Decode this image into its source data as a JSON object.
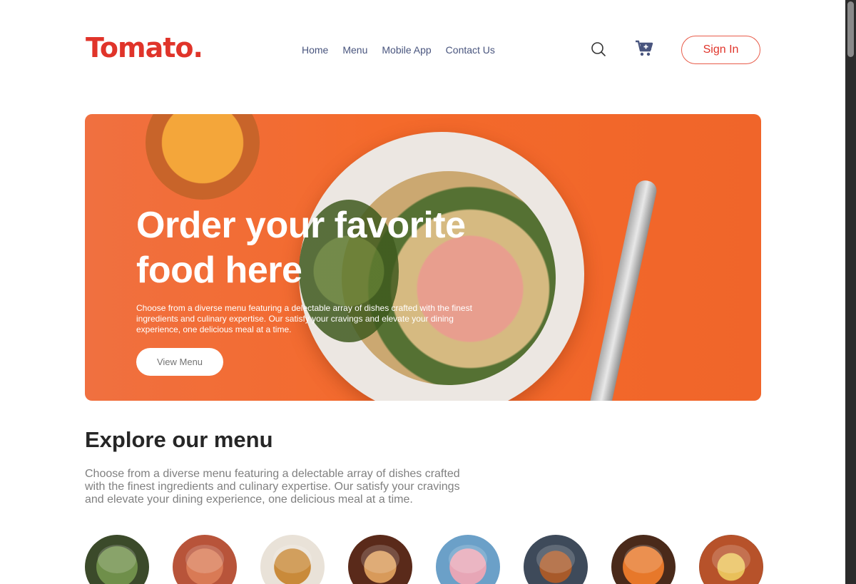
{
  "navbar": {
    "logo_text": "Tomato.",
    "links": [
      "Home",
      "Menu",
      "Mobile App",
      "Contact Us"
    ],
    "search_icon": "search-icon",
    "cart_icon": "cart-icon",
    "signin_label": "Sign In",
    "accent_color": "#e0342a"
  },
  "hero": {
    "title": "Order your favorite food here",
    "description": "Choose from a diverse menu featuring a delectable array of dishes crafted with the finest ingredients and culinary expertise. Our satisfy your cravings and elevate your dining experience, one delicious meal at a time.",
    "button_label": "View Menu",
    "background_color": "#f46a2b"
  },
  "explore": {
    "title": "Explore our menu",
    "description": "Choose from a diverse menu featuring a delectable array of dishes crafted with the finest ingredients and culinary expertise. Our satisfy your cravings and elevate your dining experience, one delicious meal at a time."
  }
}
